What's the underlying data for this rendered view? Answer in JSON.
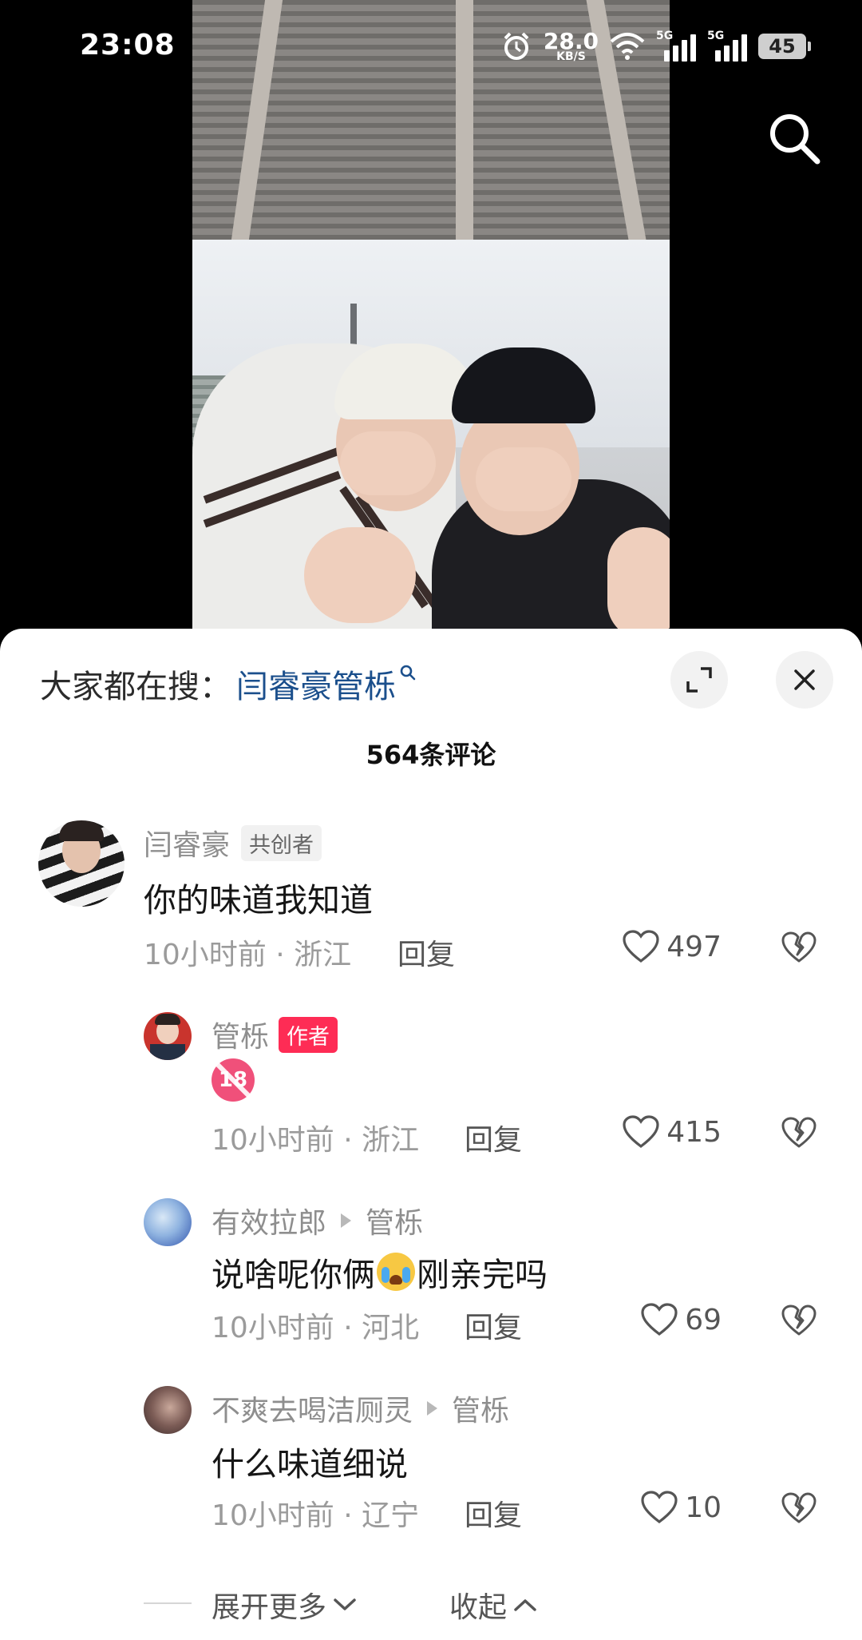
{
  "status_bar": {
    "time": "23:08",
    "net_speed_value": "28.0",
    "net_speed_unit": "KB/S",
    "network_1": "5G",
    "network_2": "5G",
    "battery": "45"
  },
  "search_suggestion": {
    "prefix": "大家都在搜：",
    "keyword": "闫睿豪管栎"
  },
  "comment_count": "564条评论",
  "comments": [
    {
      "username": "闫睿豪",
      "badge": "共创者",
      "text": "你的味道我知道",
      "time_location": "10小时前 · 浙江",
      "reply_label": "回复",
      "likes": "497"
    },
    {
      "username": "管栎",
      "badge": "作者",
      "emoji": "18",
      "time_location": "10小时前 · 浙江",
      "reply_label": "回复",
      "likes": "415"
    },
    {
      "username": "有效拉郎",
      "reply_to": "管栎",
      "text_before": "说啥呢你俩",
      "text_after": "刚亲完吗",
      "time_location": "10小时前 · 河北",
      "reply_label": "回复",
      "likes": "69"
    },
    {
      "username": "不爽去喝洁厕灵",
      "reply_to": "管栎",
      "text": "什么味道细说",
      "time_location": "10小时前 · 辽宁",
      "reply_label": "回复",
      "likes": "10"
    }
  ],
  "expand_more": "展开更多",
  "collapse": "收起",
  "colors": {
    "accent_link": "#1b4f8c",
    "author_badge": "#fe2c55"
  }
}
